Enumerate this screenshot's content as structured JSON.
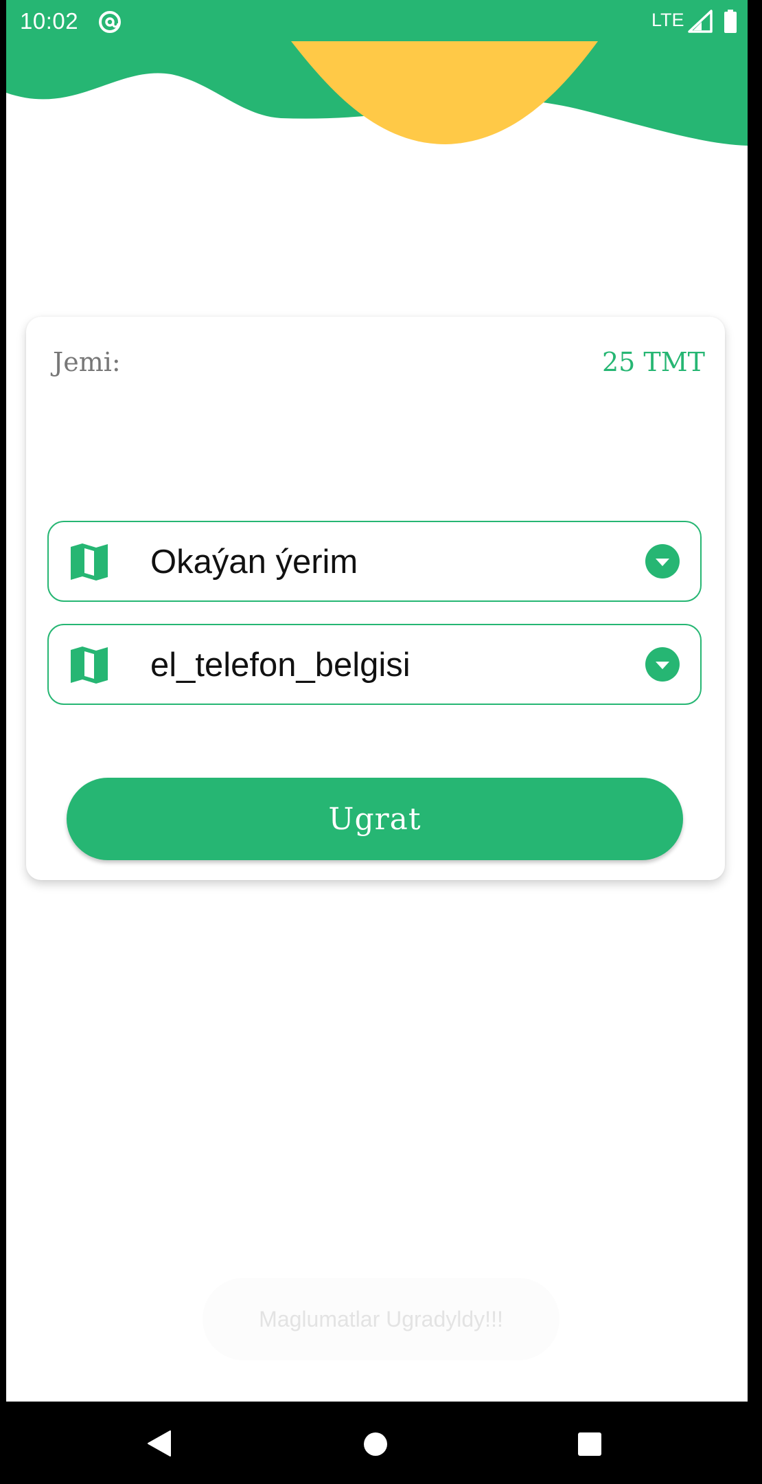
{
  "status_bar": {
    "time": "10:02",
    "network": "LTE",
    "app_icon": "at-sign-icon",
    "signal_icon": "signal-icon",
    "battery_icon": "battery-icon"
  },
  "colors": {
    "primary": "#26b673",
    "accent_yellow": "#ffc947",
    "label_gray": "#777777"
  },
  "summary": {
    "total_label": "Jemi:",
    "total_value": "25 TMT"
  },
  "form": {
    "location_select": {
      "icon": "map-icon",
      "value": "Okaýan ýerim"
    },
    "phone_select": {
      "icon": "map-icon",
      "value": "el_telefon_belgisi"
    },
    "submit_label": "Ugrat"
  },
  "toast": {
    "message": "Maglumatlar Ugradyldy!!!"
  },
  "nav": {
    "back_icon": "back-triangle-icon",
    "home_icon": "home-circle-icon",
    "recents_icon": "recents-square-icon"
  }
}
